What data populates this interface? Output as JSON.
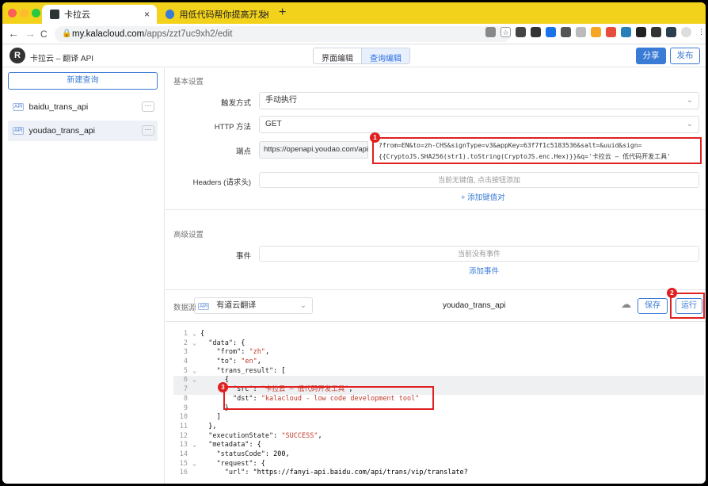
{
  "browser": {
    "tabs": [
      {
        "title": "卡拉云",
        "close": "×"
      },
      {
        "title": "用低代码帮你提高开发效率 - 卡拉云",
        "close": "×"
      }
    ],
    "new_tab": "+",
    "url_host": "my.kalacloud.com",
    "url_path": "/apps/zzt7uc9xh2/edit",
    "nav": {
      "back": "←",
      "forward": "→",
      "reload": "C"
    }
  },
  "app": {
    "logo_letter": "R",
    "title": "卡拉云 – 翻译 API",
    "mode_tabs": [
      "界面编辑",
      "查询编辑"
    ],
    "share_label": "分享",
    "publish_label": "发布"
  },
  "sidebar": {
    "new_query_label": "新建查询",
    "api_tag": "API",
    "items": [
      {
        "name": "baidu_trans_api",
        "more": "···"
      },
      {
        "name": "youdao_trans_api",
        "more": "···"
      }
    ]
  },
  "settings": {
    "basic_title": "基本设置",
    "trigger_label": "触发方式",
    "trigger_value": "手动执行",
    "method_label": "HTTP 方法",
    "method_value": "GET",
    "endpoint_label": "端点",
    "endpoint_prefix": "https://openapi.youdao.com/api",
    "endpoint_line1": "?from=EN&to=zh-CHS&signType=v3&appKey=63f7f1c5183536&salt=&uuid&sign=",
    "endpoint_line2": "{{CryptoJS.SHA256(str1).toString(CryptoJS.enc.Hex)}}&q='卡拉云 – 低代码开发工具'",
    "headers_label": "Headers (请求头)",
    "headers_empty": "当前无键值, 点击按钮添加",
    "add_kv": "+ 添加键值对",
    "advanced_title": "高级设置",
    "events_label": "事件",
    "events_empty": "当前没有事件",
    "add_event": "添加事件"
  },
  "datasource": {
    "label": "数据源",
    "api_tag": "API",
    "value": "有道云翻译",
    "query_name": "youdao_trans_api",
    "save_label": "保存",
    "run_label": "运行"
  },
  "annotations": [
    "1",
    "2",
    "3"
  ],
  "code_lines": [
    {
      "n": "1",
      "f": "⌄",
      "t": "{"
    },
    {
      "n": "2",
      "f": "⌄",
      "t": "  \"data\": {"
    },
    {
      "n": "3",
      "f": "",
      "t": "    \"from\": \"zh\","
    },
    {
      "n": "4",
      "f": "",
      "t": "    \"to\": \"en\","
    },
    {
      "n": "5",
      "f": "⌄",
      "t": "    \"trans_result\": ["
    },
    {
      "n": "6",
      "f": "⌄",
      "t": "      {"
    },
    {
      "n": "7",
      "f": "",
      "t": "        \"src\": \"卡拉云 – 低代码开发工具\","
    },
    {
      "n": "8",
      "f": "",
      "t": "        \"dst\": \"kalacloud - low code development tool\""
    },
    {
      "n": "9",
      "f": "",
      "t": "      }"
    },
    {
      "n": "10",
      "f": "",
      "t": "    ]"
    },
    {
      "n": "11",
      "f": "",
      "t": "  },"
    },
    {
      "n": "12",
      "f": "",
      "t": "  \"executionState\": \"SUCCESS\","
    },
    {
      "n": "13",
      "f": "⌄",
      "t": "  \"metadata\": {"
    },
    {
      "n": "14",
      "f": "",
      "t": "    \"statusCode\": 200,"
    },
    {
      "n": "15",
      "f": "⌄",
      "t": "    \"request\": {"
    },
    {
      "n": "16",
      "f": "",
      "t": "      \"url\": \"https://fanyi-api.baidu.com/api/trans/vip/translate?"
    }
  ],
  "colors": {
    "accent": "#3a7bd5",
    "tabstrip": "#f2d21a",
    "highlight": "#e02020"
  }
}
